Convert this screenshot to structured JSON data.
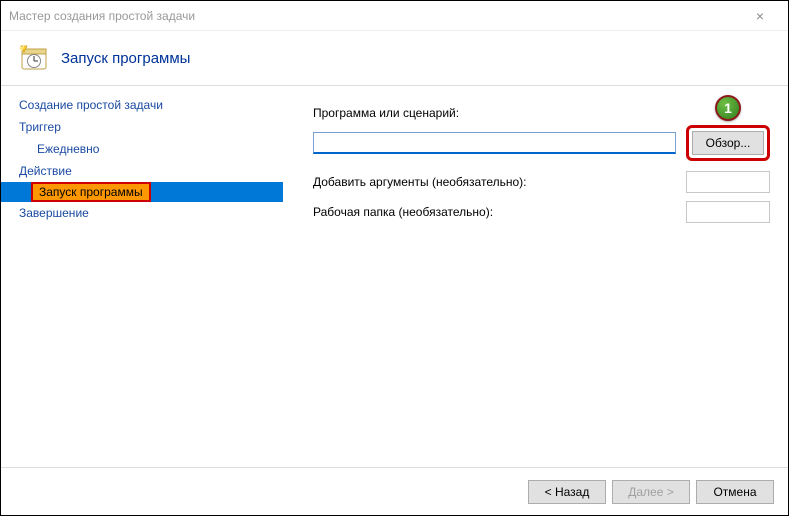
{
  "window": {
    "title": "Мастер создания простой задачи"
  },
  "header": {
    "title": "Запуск программы"
  },
  "sidebar": {
    "items": [
      {
        "label": "Создание простой задачи"
      },
      {
        "label": "Триггер"
      },
      {
        "label": "Ежедневно"
      },
      {
        "label": "Действие"
      },
      {
        "label": "Запуск программы"
      },
      {
        "label": "Завершение"
      }
    ]
  },
  "main": {
    "program_label": "Программа или сценарий:",
    "program_value": "",
    "browse_label": "Обзор...",
    "arguments_label": "Добавить аргументы (необязательно):",
    "arguments_value": "",
    "startin_label": "Рабочая папка (необязательно):",
    "startin_value": ""
  },
  "footer": {
    "back": "< Назад",
    "next": "Далее >",
    "cancel": "Отмена"
  },
  "annotation": {
    "callout": "1"
  }
}
